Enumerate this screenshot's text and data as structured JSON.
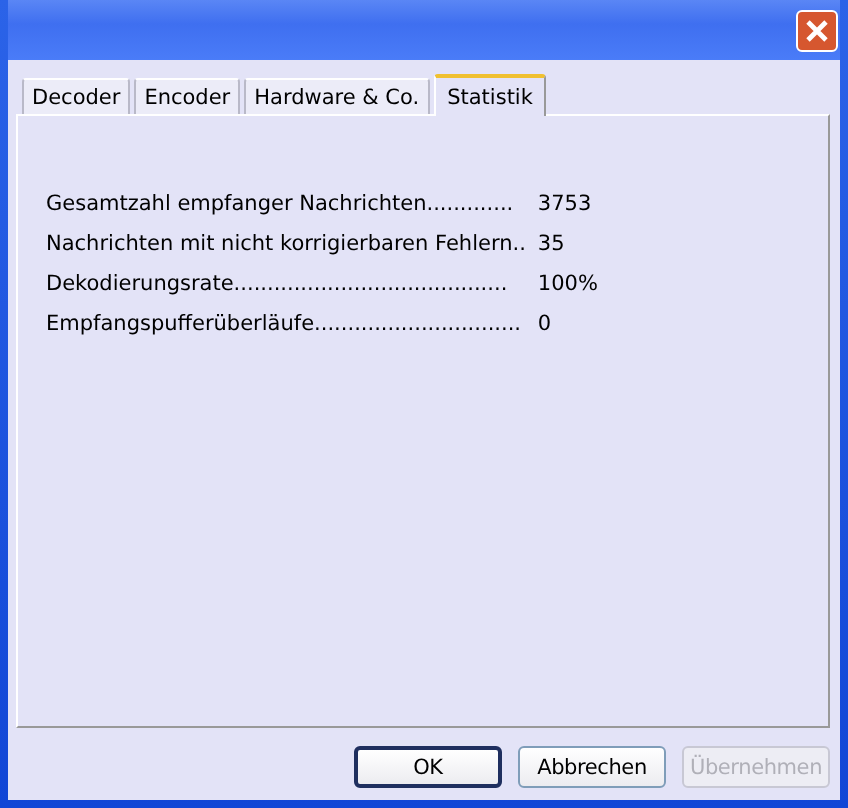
{
  "tabs": [
    {
      "label": "Decoder",
      "selected": false
    },
    {
      "label": "Encoder",
      "selected": false
    },
    {
      "label": "Hardware & Co.",
      "selected": false
    },
    {
      "label": "Statistik",
      "selected": true
    }
  ],
  "stats": [
    {
      "label": "Gesamtzahl empfanger Nachrichten.............",
      "value": "3753"
    },
    {
      "label": "Nachrichten mit nicht korrigierbaren Fehlern..",
      "value": "35"
    },
    {
      "label": "Dekodierungsrate.........................................",
      "value": "100%"
    },
    {
      "label": "Empfangspufferüberläufe...............................",
      "value": "0"
    }
  ],
  "buttons": [
    {
      "label": "OK",
      "default": true,
      "disabled": false
    },
    {
      "label": "Abbrechen",
      "default": false,
      "disabled": false
    },
    {
      "label": "Übernehmen",
      "default": false,
      "disabled": true
    }
  ]
}
